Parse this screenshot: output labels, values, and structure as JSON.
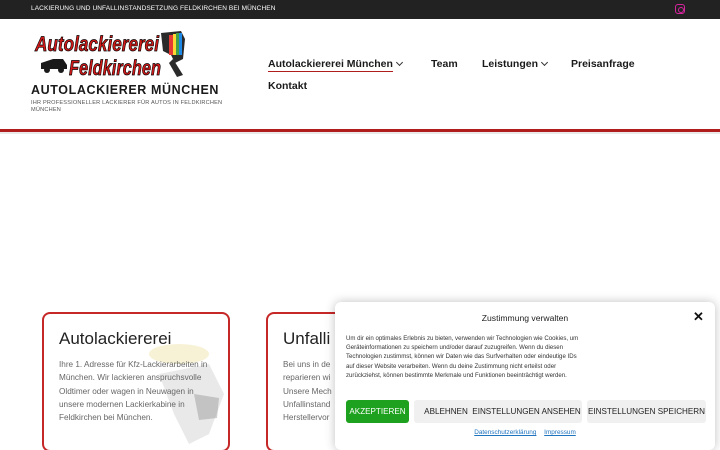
{
  "topbar": {
    "tagline": "LACKIERUNG UND UNFALLINSTANDSETZUNG FELDKIRCHEN BEI MÜNCHEN",
    "social_icon": "instagram-icon"
  },
  "header": {
    "logo_line1": "Autolackiererei",
    "logo_line2": "Feldkirchen",
    "site_title": "AUTOLACKIERER MÜNCHEN",
    "site_tagline": "IHR PROFESSIONELLER LACKIERER FÜR AUTOS IN FELDKIRCHEN MÜNCHEN"
  },
  "nav": {
    "items": [
      {
        "label": "Autolackiererei München",
        "has_dropdown": true,
        "active": true
      },
      {
        "label": "Team",
        "has_dropdown": false
      },
      {
        "label": "Leistungen",
        "has_dropdown": true
      },
      {
        "label": "Preisanfrage",
        "has_dropdown": false
      },
      {
        "label": "Kontakt",
        "has_dropdown": false
      }
    ]
  },
  "cards": [
    {
      "title": "Autolackiererei",
      "text": "Ihre 1. Adresse für Kfz-Lackierarbeiten in München. Wir lackieren anspruchsvolle Oldtimer oder wagen in Neuwagen in unsere modernen Lackierkabine in Feldkirchen bei München."
    },
    {
      "title": "Unfalli",
      "text": "Bei uns in de reparieren wi Unsere Mech Unfallinstand Herstellervor"
    }
  ],
  "consent": {
    "title": "Zustimmung verwalten",
    "close_icon": "close-icon",
    "text": "Um dir ein optimales Erlebnis zu bieten, verwenden wir Technologien wie Cookies, um Geräteinformationen zu speichern und/oder darauf zuzugreifen. Wenn du diesen Technologien zustimmst, können wir Daten wie das Surfverhalten oder eindeutige IDs auf dieser Website verarbeiten. Wenn du deine Zustimmung nicht erteilst oder zurückziehst, können bestimmte Merkmale und Funktionen beeinträchtigt werden.",
    "buttons": {
      "accept": "AKZEPTIEREN",
      "deny": "ABLEHNEN",
      "view_preferences": "EINSTELLUNGEN ANSEHEN",
      "save_preferences": "EINSTELLUNGEN SPEICHERN"
    },
    "links": {
      "privacy": "Datenschutzerklärung",
      "imprint": "Impressum"
    }
  },
  "colors": {
    "accent_red": "#b11d1d",
    "accept_green": "#1ea11e",
    "topbar": "#222222",
    "link_blue": "#1e73be"
  }
}
